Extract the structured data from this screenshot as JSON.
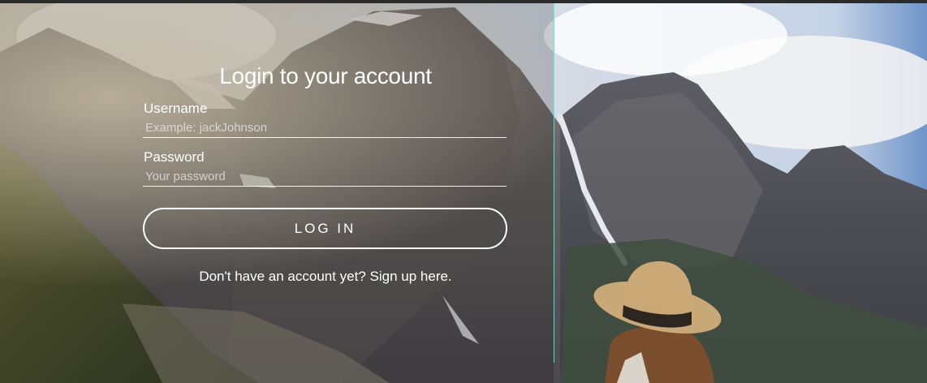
{
  "login": {
    "title": "Login to your account",
    "username_label": "Username",
    "username_placeholder": "Example: jackJohnson",
    "username_value": "",
    "password_label": "Password",
    "password_placeholder": "Your password",
    "password_value": "",
    "login_button": "LOG IN",
    "signup_link": "Don't have an account yet? Sign up here."
  },
  "colors": {
    "divider": "#7fd6cf",
    "text": "#ffffff"
  }
}
